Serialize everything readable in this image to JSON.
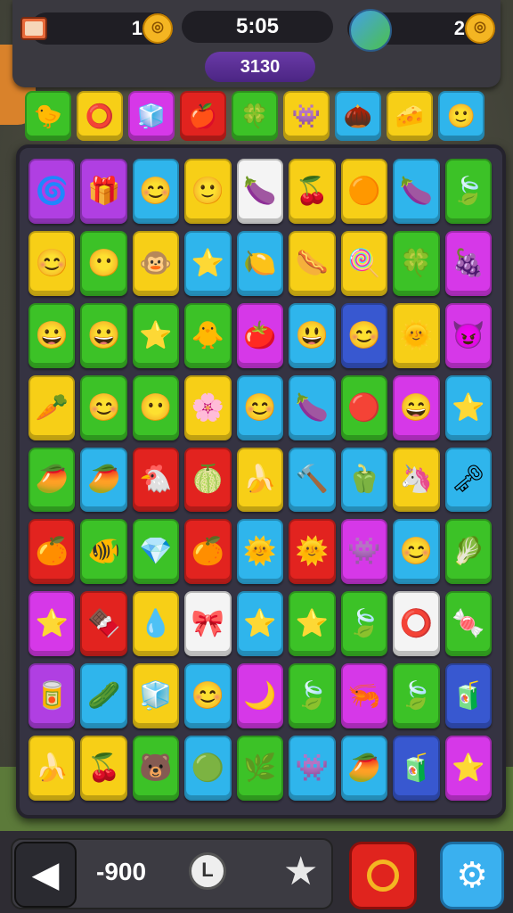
{
  "hud": {
    "left_count": "1",
    "timer": "5:05",
    "right_count": "2",
    "score": "3130",
    "left_icon": "book-icon",
    "right_icon": "globe-icon"
  },
  "top_row": [
    {
      "color": "c-green",
      "icon": "🐤"
    },
    {
      "color": "c-yellow",
      "icon": "⭕"
    },
    {
      "color": "c-magenta",
      "icon": "🧊"
    },
    {
      "color": "c-red",
      "icon": "🍎"
    },
    {
      "color": "c-green",
      "icon": "🍀"
    },
    {
      "color": "c-yellow",
      "icon": "👾"
    },
    {
      "color": "c-blue",
      "icon": "🌰"
    },
    {
      "color": "c-yellow",
      "icon": "🧀"
    },
    {
      "color": "c-blue",
      "icon": "🙂"
    }
  ],
  "grid": [
    [
      "c-purple",
      "🌀",
      "c-purple",
      "🎁",
      "c-blue",
      "😊",
      "c-yellow",
      "🙂",
      "c-white",
      "🍆",
      "c-yellow",
      "🍒",
      "c-yellow",
      "🟠",
      "c-blue",
      "🍆",
      "c-green",
      "🍃"
    ],
    [
      "c-yellow",
      "😊",
      "c-green",
      "😶",
      "c-yellow",
      "🐵",
      "c-blue",
      "⭐",
      "c-blue",
      "🍋",
      "c-yellow",
      "🌭",
      "c-yellow",
      "🍭",
      "c-green",
      "🍀",
      "c-magenta",
      "🍇"
    ],
    [
      "c-green",
      "😀",
      "c-green",
      "😀",
      "c-green",
      "⭐",
      "c-green",
      "🐥",
      "c-magenta",
      "🍅",
      "c-blue",
      "😃",
      "c-navy",
      "😊",
      "c-yellow",
      "🌞",
      "c-magenta",
      "😈"
    ],
    [
      "c-yellow",
      "🥕",
      "c-green",
      "😊",
      "c-green",
      "😶",
      "c-yellow",
      "🌸",
      "c-blue",
      "😊",
      "c-blue",
      "🍆",
      "c-green",
      "🔴",
      "c-magenta",
      "😄",
      "c-blue",
      "⭐"
    ],
    [
      "c-green",
      "🥭",
      "c-blue",
      "🥭",
      "c-red",
      "🐔",
      "c-red",
      "🍈",
      "c-yellow",
      "🍌",
      "c-blue",
      "🔨",
      "c-blue",
      "🫑",
      "c-yellow",
      "🦄",
      "c-blue",
      "🗝"
    ],
    [
      "c-red",
      "🍊",
      "c-green",
      "🐠",
      "c-green",
      "💎",
      "c-red",
      "🍊",
      "c-blue",
      "🌞",
      "c-red",
      "🌞",
      "c-magenta",
      "👾",
      "c-blue",
      "😊",
      "c-green",
      "🥬"
    ],
    [
      "c-magenta",
      "⭐",
      "c-red",
      "🍫",
      "c-yellow",
      "💧",
      "c-white",
      "🎀",
      "c-blue",
      "⭐",
      "c-green",
      "⭐",
      "c-green",
      "🍃",
      "c-white",
      "⭕",
      "c-green",
      "🍬"
    ],
    [
      "c-purple",
      "🥫",
      "c-blue",
      "🥒",
      "c-yellow",
      "🧊",
      "c-blue",
      "😊",
      "c-magenta",
      "🌙",
      "c-green",
      "🍃",
      "c-magenta",
      "🦐",
      "c-green",
      "🍃",
      "c-navy",
      "🧃"
    ],
    [
      "c-yellow",
      "🍌",
      "c-yellow",
      "🍒",
      "c-green",
      "🐻",
      "c-blue",
      "🟢",
      "c-green",
      "🌿",
      "c-blue",
      "👾",
      "c-blue",
      "🥭",
      "c-navy",
      "🧃",
      "c-magenta",
      "⭐"
    ]
  ],
  "bottom": {
    "text": "-900",
    "back_icon": "back-arrow-icon",
    "clock_icon": "clock-icon",
    "star_icon": "star-icon",
    "power_icon": "power-button-icon",
    "settings_icon": "gear-icon"
  }
}
